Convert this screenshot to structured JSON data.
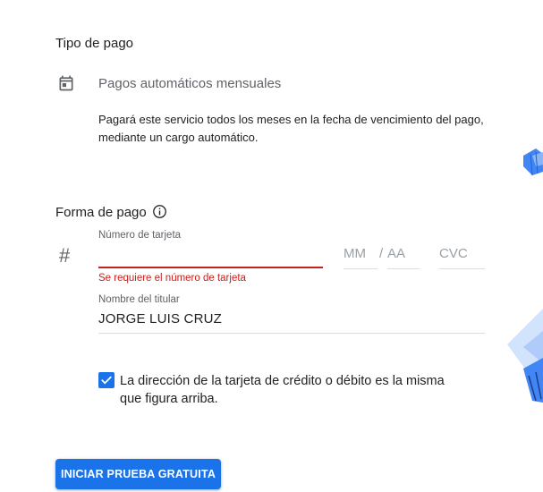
{
  "payment_type": {
    "title": "Tipo de pago",
    "option_label": "Pagos automáticos mensuales",
    "description": "Pagará este servicio todos los meses en la fecha de vencimiento del pago, mediante un cargo automático."
  },
  "payment_method": {
    "title": "Forma de pago",
    "card_number": {
      "label": "Número de tarjeta",
      "value": "",
      "error": "Se requiere el número de tarjeta"
    },
    "expiry": {
      "month_placeholder": "MM",
      "separator": "/",
      "year_placeholder": "AA"
    },
    "cvc": {
      "placeholder": "CVC"
    },
    "cardholder": {
      "label": "Nombre del titular",
      "value": "JORGE LUIS CRUZ"
    },
    "same_address": {
      "checked": true,
      "label": "La dirección de la tarjeta de crédito o débito es la misma que figura arriba."
    }
  },
  "actions": {
    "start_trial_label": "INICIAR PRUEBA GRATUITA"
  },
  "colors": {
    "accent": "#1a73e8",
    "error": "#c5221f",
    "muted": "#5f6368"
  },
  "icons": {
    "payment_type": "calendar-icon",
    "payment_method_info": "info-icon",
    "card": "hash-icon",
    "checkbox": "check-icon"
  }
}
